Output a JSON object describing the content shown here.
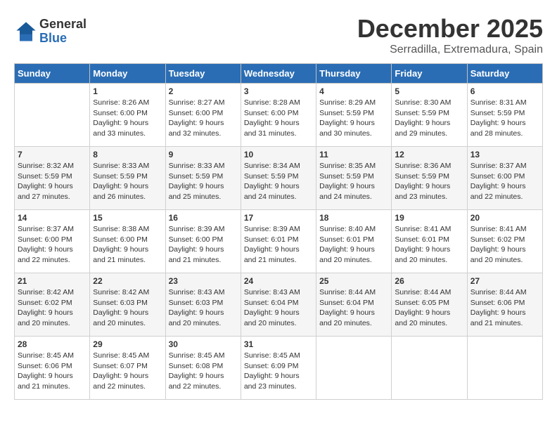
{
  "logo": {
    "general": "General",
    "blue": "Blue"
  },
  "title": {
    "month": "December 2025",
    "location": "Serradilla, Extremadura, Spain"
  },
  "headers": [
    "Sunday",
    "Monday",
    "Tuesday",
    "Wednesday",
    "Thursday",
    "Friday",
    "Saturday"
  ],
  "weeks": [
    [
      {
        "day": "",
        "sunrise": "",
        "sunset": "",
        "daylight": ""
      },
      {
        "day": "1",
        "sunrise": "Sunrise: 8:26 AM",
        "sunset": "Sunset: 6:00 PM",
        "daylight": "Daylight: 9 hours and 33 minutes."
      },
      {
        "day": "2",
        "sunrise": "Sunrise: 8:27 AM",
        "sunset": "Sunset: 6:00 PM",
        "daylight": "Daylight: 9 hours and 32 minutes."
      },
      {
        "day": "3",
        "sunrise": "Sunrise: 8:28 AM",
        "sunset": "Sunset: 6:00 PM",
        "daylight": "Daylight: 9 hours and 31 minutes."
      },
      {
        "day": "4",
        "sunrise": "Sunrise: 8:29 AM",
        "sunset": "Sunset: 5:59 PM",
        "daylight": "Daylight: 9 hours and 30 minutes."
      },
      {
        "day": "5",
        "sunrise": "Sunrise: 8:30 AM",
        "sunset": "Sunset: 5:59 PM",
        "daylight": "Daylight: 9 hours and 29 minutes."
      },
      {
        "day": "6",
        "sunrise": "Sunrise: 8:31 AM",
        "sunset": "Sunset: 5:59 PM",
        "daylight": "Daylight: 9 hours and 28 minutes."
      }
    ],
    [
      {
        "day": "7",
        "sunrise": "Sunrise: 8:32 AM",
        "sunset": "Sunset: 5:59 PM",
        "daylight": "Daylight: 9 hours and 27 minutes."
      },
      {
        "day": "8",
        "sunrise": "Sunrise: 8:33 AM",
        "sunset": "Sunset: 5:59 PM",
        "daylight": "Daylight: 9 hours and 26 minutes."
      },
      {
        "day": "9",
        "sunrise": "Sunrise: 8:33 AM",
        "sunset": "Sunset: 5:59 PM",
        "daylight": "Daylight: 9 hours and 25 minutes."
      },
      {
        "day": "10",
        "sunrise": "Sunrise: 8:34 AM",
        "sunset": "Sunset: 5:59 PM",
        "daylight": "Daylight: 9 hours and 24 minutes."
      },
      {
        "day": "11",
        "sunrise": "Sunrise: 8:35 AM",
        "sunset": "Sunset: 5:59 PM",
        "daylight": "Daylight: 9 hours and 24 minutes."
      },
      {
        "day": "12",
        "sunrise": "Sunrise: 8:36 AM",
        "sunset": "Sunset: 5:59 PM",
        "daylight": "Daylight: 9 hours and 23 minutes."
      },
      {
        "day": "13",
        "sunrise": "Sunrise: 8:37 AM",
        "sunset": "Sunset: 6:00 PM",
        "daylight": "Daylight: 9 hours and 22 minutes."
      }
    ],
    [
      {
        "day": "14",
        "sunrise": "Sunrise: 8:37 AM",
        "sunset": "Sunset: 6:00 PM",
        "daylight": "Daylight: 9 hours and 22 minutes."
      },
      {
        "day": "15",
        "sunrise": "Sunrise: 8:38 AM",
        "sunset": "Sunset: 6:00 PM",
        "daylight": "Daylight: 9 hours and 21 minutes."
      },
      {
        "day": "16",
        "sunrise": "Sunrise: 8:39 AM",
        "sunset": "Sunset: 6:00 PM",
        "daylight": "Daylight: 9 hours and 21 minutes."
      },
      {
        "day": "17",
        "sunrise": "Sunrise: 8:39 AM",
        "sunset": "Sunset: 6:01 PM",
        "daylight": "Daylight: 9 hours and 21 minutes."
      },
      {
        "day": "18",
        "sunrise": "Sunrise: 8:40 AM",
        "sunset": "Sunset: 6:01 PM",
        "daylight": "Daylight: 9 hours and 20 minutes."
      },
      {
        "day": "19",
        "sunrise": "Sunrise: 8:41 AM",
        "sunset": "Sunset: 6:01 PM",
        "daylight": "Daylight: 9 hours and 20 minutes."
      },
      {
        "day": "20",
        "sunrise": "Sunrise: 8:41 AM",
        "sunset": "Sunset: 6:02 PM",
        "daylight": "Daylight: 9 hours and 20 minutes."
      }
    ],
    [
      {
        "day": "21",
        "sunrise": "Sunrise: 8:42 AM",
        "sunset": "Sunset: 6:02 PM",
        "daylight": "Daylight: 9 hours and 20 minutes."
      },
      {
        "day": "22",
        "sunrise": "Sunrise: 8:42 AM",
        "sunset": "Sunset: 6:03 PM",
        "daylight": "Daylight: 9 hours and 20 minutes."
      },
      {
        "day": "23",
        "sunrise": "Sunrise: 8:43 AM",
        "sunset": "Sunset: 6:03 PM",
        "daylight": "Daylight: 9 hours and 20 minutes."
      },
      {
        "day": "24",
        "sunrise": "Sunrise: 8:43 AM",
        "sunset": "Sunset: 6:04 PM",
        "daylight": "Daylight: 9 hours and 20 minutes."
      },
      {
        "day": "25",
        "sunrise": "Sunrise: 8:44 AM",
        "sunset": "Sunset: 6:04 PM",
        "daylight": "Daylight: 9 hours and 20 minutes."
      },
      {
        "day": "26",
        "sunrise": "Sunrise: 8:44 AM",
        "sunset": "Sunset: 6:05 PM",
        "daylight": "Daylight: 9 hours and 20 minutes."
      },
      {
        "day": "27",
        "sunrise": "Sunrise: 8:44 AM",
        "sunset": "Sunset: 6:06 PM",
        "daylight": "Daylight: 9 hours and 21 minutes."
      }
    ],
    [
      {
        "day": "28",
        "sunrise": "Sunrise: 8:45 AM",
        "sunset": "Sunset: 6:06 PM",
        "daylight": "Daylight: 9 hours and 21 minutes."
      },
      {
        "day": "29",
        "sunrise": "Sunrise: 8:45 AM",
        "sunset": "Sunset: 6:07 PM",
        "daylight": "Daylight: 9 hours and 22 minutes."
      },
      {
        "day": "30",
        "sunrise": "Sunrise: 8:45 AM",
        "sunset": "Sunset: 6:08 PM",
        "daylight": "Daylight: 9 hours and 22 minutes."
      },
      {
        "day": "31",
        "sunrise": "Sunrise: 8:45 AM",
        "sunset": "Sunset: 6:09 PM",
        "daylight": "Daylight: 9 hours and 23 minutes."
      },
      {
        "day": "",
        "sunrise": "",
        "sunset": "",
        "daylight": ""
      },
      {
        "day": "",
        "sunrise": "",
        "sunset": "",
        "daylight": ""
      },
      {
        "day": "",
        "sunrise": "",
        "sunset": "",
        "daylight": ""
      }
    ]
  ]
}
